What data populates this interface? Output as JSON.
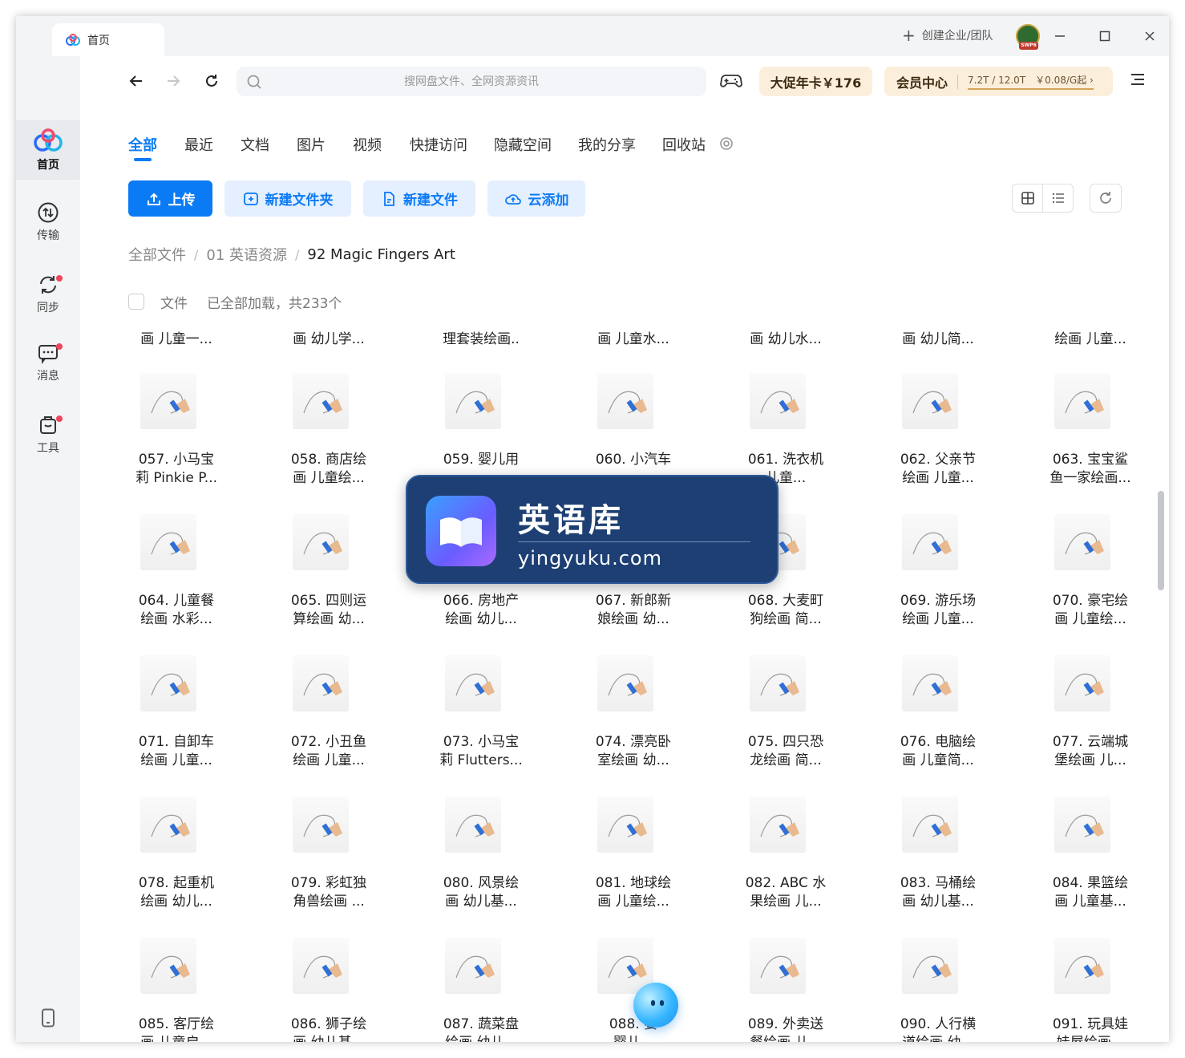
{
  "window": {
    "tab_title": "首页",
    "create_team": "创建企业/团队",
    "avatar_badge": "SWP6"
  },
  "sidebar": {
    "items": [
      {
        "label": "首页",
        "icon": "baidu-netdisk-logo-icon"
      },
      {
        "label": "传输",
        "icon": "transfer-icon"
      },
      {
        "label": "同步",
        "icon": "sync-icon"
      },
      {
        "label": "消息",
        "icon": "message-icon"
      },
      {
        "label": "工具",
        "icon": "toolbox-icon"
      }
    ]
  },
  "toolbar": {
    "search_placeholder": "搜网盘文件、全网资源资讯",
    "promo": "大促年卡￥176",
    "vip_label": "会员中心",
    "vip_quota": "7.2T / 12.0T　￥0.08/G起 ›"
  },
  "categories": [
    "全部",
    "最近",
    "文档",
    "图片",
    "视频",
    "快捷访问",
    "隐藏空间",
    "我的分享",
    "回收站"
  ],
  "actions": {
    "upload": "上传",
    "new_folder": "新建文件夹",
    "new_file": "新建文件",
    "cloud_add": "云添加"
  },
  "breadcrumb": {
    "root": "全部文件",
    "level1": "01 英语资源",
    "current": "92 Magic Fingers Art"
  },
  "list_header": {
    "label": "文件",
    "status": "已全部加载，共233个"
  },
  "top_row": [
    "画 儿童一...",
    "画 幼儿学...",
    "理套装绘画..",
    "画 儿童水...",
    "画 幼儿水...",
    "画 幼儿简...",
    "绘画 儿童..."
  ],
  "files": [
    {
      "l1": "057. 小马宝",
      "l2": "莉 Pinkie P..."
    },
    {
      "l1": "058. 商店绘",
      "l2": "画 儿童绘..."
    },
    {
      "l1": "059. 婴儿用",
      "l2": ""
    },
    {
      "l1": "060. 小汽车",
      "l2": ""
    },
    {
      "l1": "061. 洗衣机",
      "l2": "儿童..."
    },
    {
      "l1": "062. 父亲节",
      "l2": "绘画 儿童..."
    },
    {
      "l1": "063. 宝宝鲨",
      "l2": "鱼一家绘画..."
    },
    {
      "l1": "064. 儿童餐",
      "l2": "绘画 水彩..."
    },
    {
      "l1": "065. 四则运",
      "l2": "算绘画 幼..."
    },
    {
      "l1": "066. 房地产",
      "l2": "绘画 幼儿..."
    },
    {
      "l1": "067. 新郎新",
      "l2": "娘绘画 幼..."
    },
    {
      "l1": "068. 大麦町",
      "l2": "狗绘画 简..."
    },
    {
      "l1": "069. 游乐场",
      "l2": "绘画 儿童..."
    },
    {
      "l1": "070. 豪宅绘",
      "l2": "画 儿童绘..."
    },
    {
      "l1": "071. 自卸车",
      "l2": "绘画 儿童..."
    },
    {
      "l1": "072. 小丑鱼",
      "l2": "绘画 儿童..."
    },
    {
      "l1": "073. 小马宝",
      "l2": "莉 Flutters..."
    },
    {
      "l1": "074. 漂亮卧",
      "l2": "室绘画 幼..."
    },
    {
      "l1": "075. 四只恐",
      "l2": "龙绘画 简..."
    },
    {
      "l1": "076. 电脑绘",
      "l2": "画 儿童简..."
    },
    {
      "l1": "077. 云端城",
      "l2": "堡绘画 儿..."
    },
    {
      "l1": "078. 起重机",
      "l2": "绘画 幼儿..."
    },
    {
      "l1": "079. 彩虹独",
      "l2": "角兽绘画 ..."
    },
    {
      "l1": "080. 风景绘",
      "l2": "画 幼儿基..."
    },
    {
      "l1": "081. 地球绘",
      "l2": "画 儿童绘..."
    },
    {
      "l1": "082. ABC 水",
      "l2": "果绘画 儿..."
    },
    {
      "l1": "083. 马桶绘",
      "l2": "画 幼儿基..."
    },
    {
      "l1": "084. 果篮绘",
      "l2": "画 儿童基..."
    },
    {
      "l1": "085. 客厅绘",
      "l2": "画 儿童启..."
    },
    {
      "l1": "086. 狮子绘",
      "l2": "画 幼儿基..."
    },
    {
      "l1": "087. 蔬菜盘",
      "l2": "绘画 幼儿..."
    },
    {
      "l1": "088. 婴",
      "l2": "婴儿..."
    },
    {
      "l1": "089. 外卖送",
      "l2": "餐绘画 儿..."
    },
    {
      "l1": "090. 人行横",
      "l2": "道绘画 幼..."
    },
    {
      "l1": "091. 玩具娃",
      "l2": "娃屋绘画..."
    }
  ],
  "watermark": {
    "title": "英语库",
    "url": "yingyuku.com"
  },
  "colors": {
    "accent": "#0b7bf5",
    "promo_bg": "#fbefdc",
    "sidebar_bg": "#f3f4f6"
  }
}
